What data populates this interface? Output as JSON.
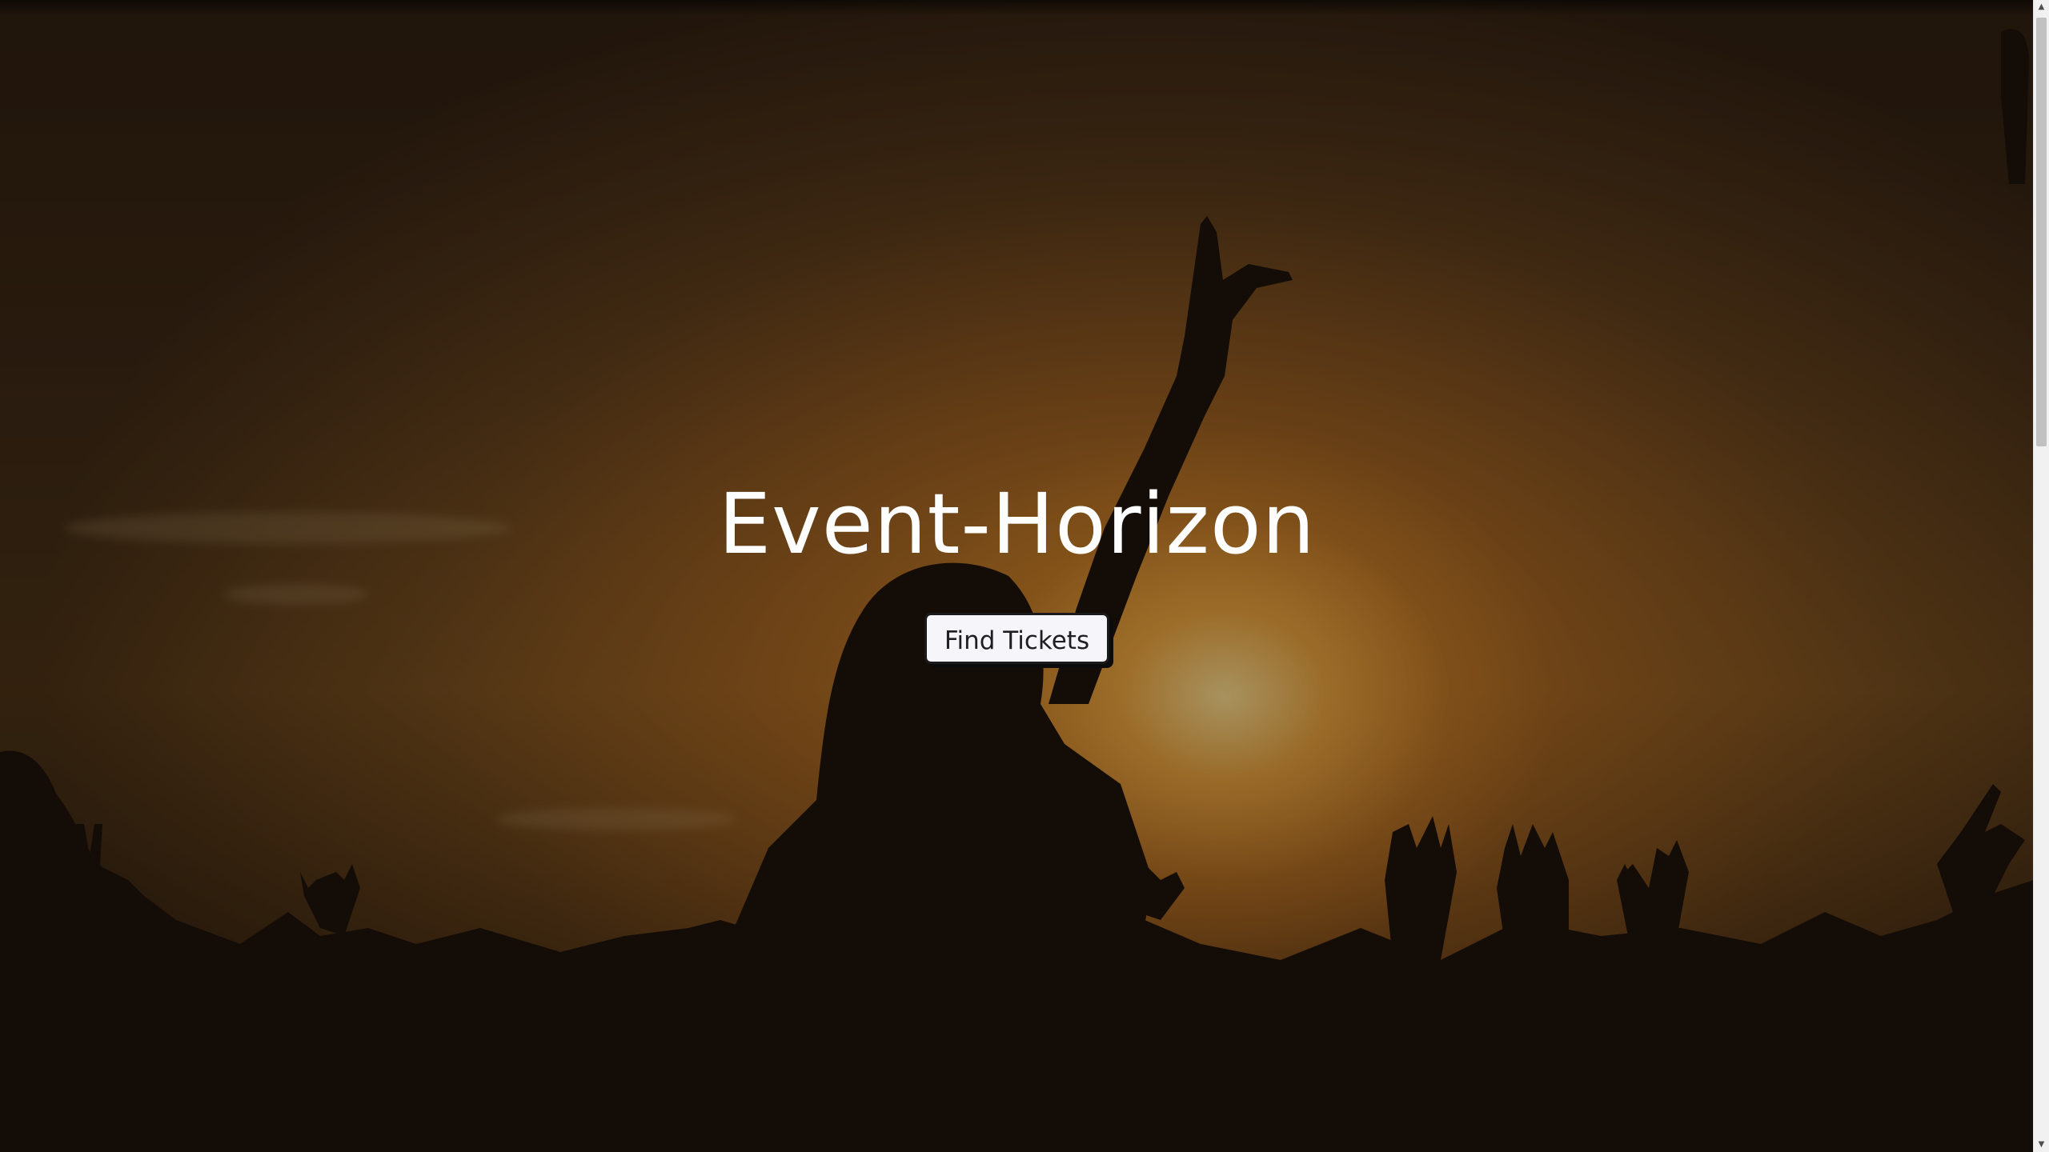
{
  "hero": {
    "title": "Event-Horizon",
    "cta_label": "Find Tickets",
    "background_description_icon": "concert-crowd-sunset-photo"
  },
  "colors": {
    "title": "#ffffff",
    "button_bg": "#f6f6fa",
    "button_text": "#1e1e24",
    "button_border": "#1b1b1b"
  },
  "scrollbar": {
    "up_icon": "▲",
    "down_icon": "▼"
  }
}
